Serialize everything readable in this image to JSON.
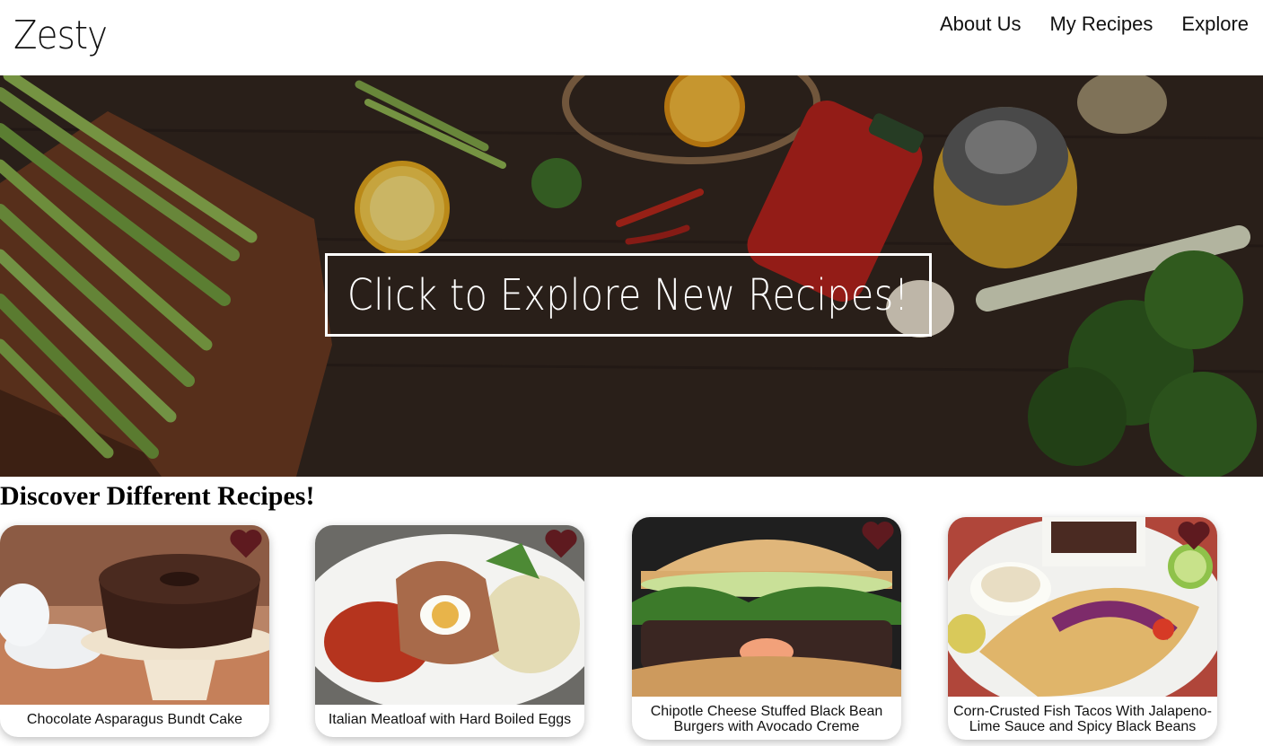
{
  "header": {
    "logo": "Zesty",
    "nav": [
      "About Us",
      "My Recipes",
      "Explore"
    ]
  },
  "hero": {
    "cta_label": "Click to Explore New Recipes!"
  },
  "section": {
    "title": "Discover Different Recipes!"
  },
  "recipes": [
    {
      "title": "Chocolate Asparagus Bundt Cake"
    },
    {
      "title": "Italian Meatloaf with Hard Boiled Eggs"
    },
    {
      "title": "Chipotle Cheese Stuffed Black Bean Burgers with Avocado Creme"
    },
    {
      "title": "Corn-Crusted Fish Tacos With Jalapeno-Lime Sauce and Spicy Black Beans"
    }
  ],
  "colors": {
    "heart": "#5e1a1f",
    "text": "#111111"
  },
  "icons": {
    "favorite": "heart-icon"
  }
}
